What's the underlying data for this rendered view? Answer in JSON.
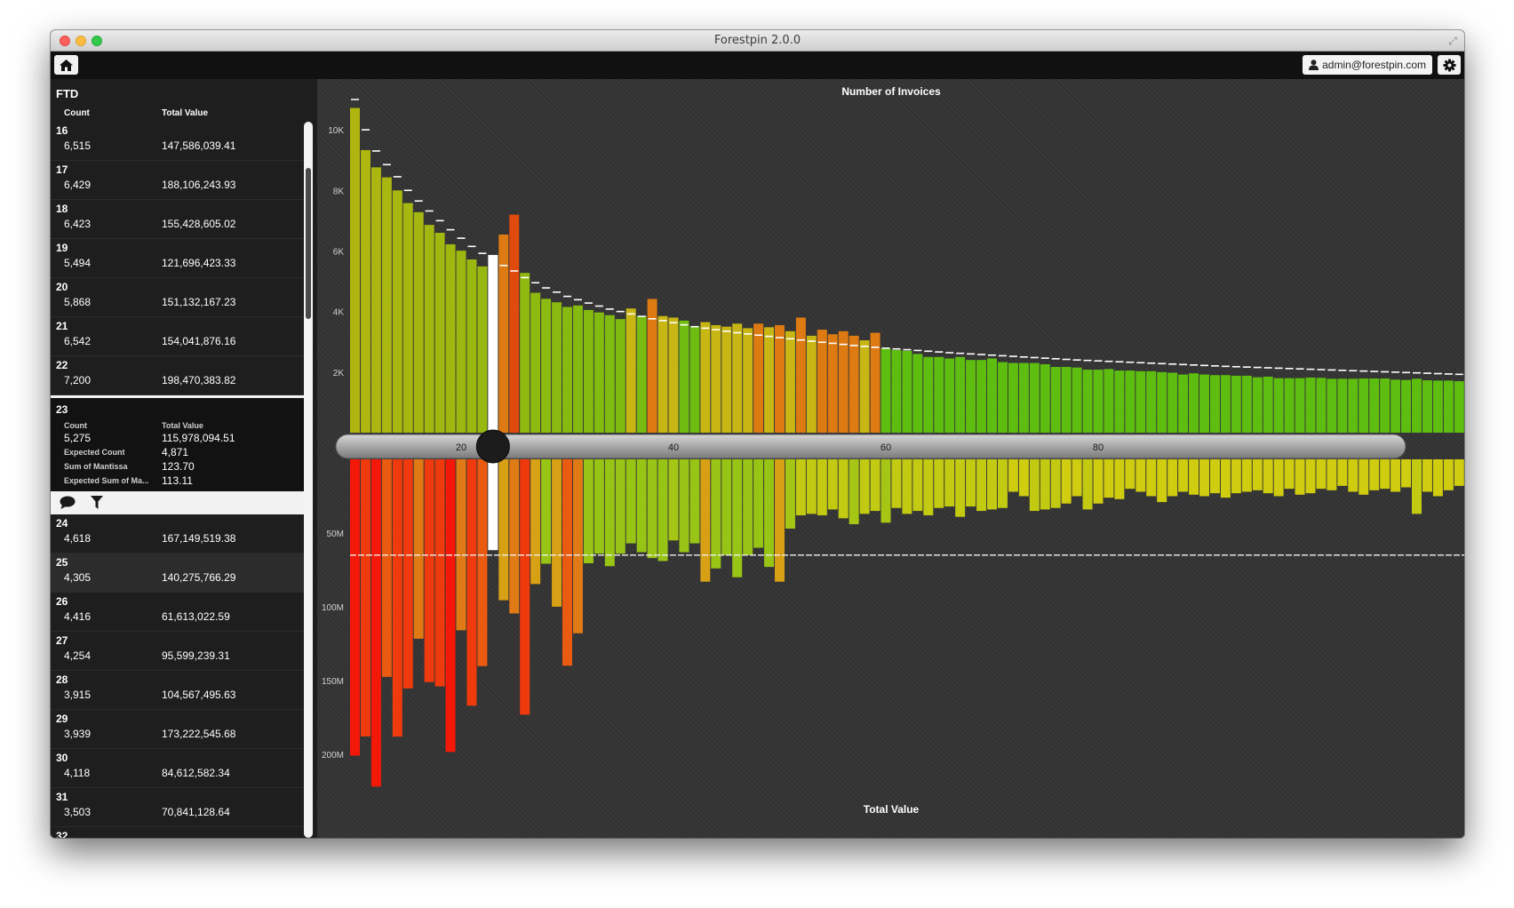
{
  "window": {
    "title": "Forestpin 2.0.0"
  },
  "toolbar": {
    "user": "admin@forestpin.com",
    "home_icon": "home-icon",
    "settings_icon": "gear-icon"
  },
  "sidebar": {
    "title": "FTD",
    "col_count": "Count",
    "col_total": "Total Value",
    "rows_before": [
      {
        "key": "16",
        "count": "6,515",
        "total": "147,586,039.41"
      },
      {
        "key": "17",
        "count": "6,429",
        "total": "188,106,243.93"
      },
      {
        "key": "18",
        "count": "6,423",
        "total": "155,428,605.02"
      },
      {
        "key": "19",
        "count": "5,494",
        "total": "121,696,423.33"
      },
      {
        "key": "20",
        "count": "5,868",
        "total": "151,132,167.23"
      },
      {
        "key": "21",
        "count": "6,542",
        "total": "154,041,876.16"
      },
      {
        "key": "22",
        "count": "7,200",
        "total": "198,470,383.82"
      }
    ],
    "selected": {
      "key": "23",
      "count_label": "Count",
      "total_label": "Total Value",
      "count": "5,275",
      "total": "115,978,094.51",
      "expected_count_label": "Expected Count",
      "expected_count": "4,871",
      "sum_mantissa_label": "Sum of Mantissa",
      "sum_mantissa": "123.70",
      "expected_sum_label": "Expected Sum of Ma...",
      "expected_sum": "113.11"
    },
    "tools": {
      "comment_icon": "comment-icon",
      "filter_icon": "filter-icon"
    },
    "rows_after": [
      {
        "key": "24",
        "count": "4,618",
        "total": "167,149,519.38"
      },
      {
        "key": "25",
        "count": "4,305",
        "total": "140,275,766.29"
      },
      {
        "key": "26",
        "count": "4,416",
        "total": "61,613,022.59"
      },
      {
        "key": "27",
        "count": "4,254",
        "total": "95,599,239.31"
      },
      {
        "key": "28",
        "count": "3,915",
        "total": "104,567,495.63"
      },
      {
        "key": "29",
        "count": "3,939",
        "total": "173,222,545.68"
      },
      {
        "key": "30",
        "count": "4,118",
        "total": "84,612,582.34"
      },
      {
        "key": "31",
        "count": "3,503",
        "total": "70,841,128.64"
      },
      {
        "key": "32",
        "count": "",
        "total": ""
      }
    ]
  },
  "chart_data": {
    "type": "bar",
    "top": {
      "title": "Number of Invoices",
      "ylim": [
        0,
        11000
      ],
      "yticks": [
        2000,
        4000,
        6000,
        8000,
        10000
      ],
      "ytick_labels": [
        "2K",
        "4K",
        "6K",
        "8K",
        "10K"
      ],
      "x_start": 10,
      "counts": [
        10720,
        9330,
        8760,
        8430,
        8000,
        7580,
        7280,
        6860,
        6600,
        6220,
        6010,
        5720,
        5490,
        5868,
        6542,
        7200,
        5275,
        4618,
        4420,
        4305,
        4150,
        4200,
        4050,
        3970,
        3880,
        3750,
        4100,
        3850,
        4416,
        3850,
        3800,
        3700,
        3500,
        3650,
        3550,
        3500,
        3600,
        3450,
        3600,
        3480,
        3550,
        3350,
        3800,
        3200,
        3400,
        3250,
        3350,
        3200,
        3050,
        3300,
        2780,
        2730,
        2700,
        2600,
        2500,
        2500,
        2450,
        2500,
        2400,
        2400,
        2450,
        2330,
        2300,
        2300,
        2300,
        2260,
        2170,
        2170,
        2150,
        2080,
        2080,
        2100,
        2050,
        2050,
        2030,
        2030,
        2000,
        1980,
        1920,
        1960,
        1920,
        1900,
        1900,
        1880,
        1880,
        1830,
        1850,
        1800,
        1800,
        1800,
        1820,
        1810,
        1780,
        1780,
        1780,
        1790,
        1790,
        1790,
        1750,
        1740,
        1780,
        1730,
        1720,
        1720,
        1700,
        1700,
        1680,
        1680,
        1650,
        1650,
        1640,
        1600,
        1640,
        1610,
        1600,
        1570,
        1560,
        1560,
        1560,
        1560
      ],
      "expected": [
        11000,
        10000,
        9300,
        8850,
        8450,
        8000,
        7650,
        7320,
        7000,
        6700,
        6420,
        6150,
        5920,
        5700,
        5520,
        5340,
        5120,
        4950,
        4780,
        4640,
        4500,
        4390,
        4280,
        4180,
        4080,
        4000,
        3920,
        3840,
        3760,
        3700,
        3630,
        3560,
        3500,
        3450,
        3400,
        3350,
        3300,
        3260,
        3220,
        3180,
        3140,
        3100,
        3060,
        3020,
        2985,
        2950,
        2915,
        2880,
        2850,
        2820,
        2790,
        2765,
        2740,
        2715,
        2690,
        2665,
        2640,
        2620,
        2600,
        2580,
        2560,
        2540,
        2520,
        2500,
        2480,
        2460,
        2440,
        2420,
        2400,
        2385,
        2370,
        2355,
        2340,
        2325,
        2310,
        2295,
        2280,
        2265,
        2250,
        2235,
        2220,
        2205,
        2190,
        2178,
        2166,
        2154,
        2142,
        2130,
        2118,
        2106,
        2094,
        2082,
        2070,
        2058,
        2046,
        2034,
        2022,
        2010,
        1998,
        1986,
        1974,
        1962,
        1950,
        1938,
        1926,
        1914,
        1902,
        1890,
        1878,
        1866,
        1854,
        1842,
        1830,
        1818,
        1806,
        1794,
        1782,
        1770,
        1758,
        1746
      ]
    },
    "bottom": {
      "title": "Total Value",
      "ylim": [
        0,
        220000000
      ],
      "yticks": [
        50000000,
        100000000,
        150000000,
        200000000
      ],
      "ytick_labels": [
        "50M",
        "100M",
        "150M",
        "200M"
      ],
      "average_line": 65000000,
      "values": [
        201000000,
        188000000,
        222000000,
        147586039,
        188106243,
        155428605,
        121696423,
        151132167,
        154041876,
        198470383,
        115978094,
        167149519,
        140275766,
        61613022,
        95599239,
        104567495,
        173222545,
        84612582,
        70841128,
        100000000,
        140000000,
        118000000,
        70500000,
        64000000,
        72500000,
        64000000,
        57000000,
        63000000,
        67000000,
        69000000,
        55000000,
        63000000,
        57000000,
        83000000,
        74000000,
        65000000,
        80000000,
        65000000,
        60000000,
        73000000,
        83000000,
        47000000,
        38000000,
        37000000,
        38000000,
        34000000,
        40000000,
        44000000,
        37000000,
        35000000,
        43000000,
        33000000,
        37000000,
        35000000,
        38000000,
        33000000,
        32000000,
        39000000,
        32000000,
        35000000,
        34000000,
        33000000,
        22000000,
        25000000,
        35000000,
        34000000,
        33000000,
        30000000,
        25000000,
        34000000,
        30000000,
        26000000,
        27000000,
        20000000,
        22000000,
        25000000,
        29000000,
        25000000,
        22000000,
        24000000,
        25000000,
        23000000,
        26000000,
        23000000,
        22000000,
        21000000,
        23000000,
        25000000,
        20000000,
        24000000,
        23000000,
        20000000,
        21000000,
        18000000,
        22000000,
        24000000,
        21000000,
        20000000,
        22000000,
        19000000,
        37000000,
        22000000,
        25000000,
        21000000,
        18000000,
        22000000,
        20000000,
        19000000,
        18000000,
        20000000,
        17000000,
        18000000,
        20000000,
        16000000,
        18000000,
        17000000,
        15000000,
        17000000,
        20000000,
        22000000
      ]
    },
    "slider": {
      "labels": [
        "20",
        "40",
        "60",
        "80"
      ],
      "label_values": [
        20,
        40,
        60,
        80
      ],
      "selected": 23
    }
  },
  "colors": {
    "window_bg": "#343434",
    "sidebar_bg": "#1e1e1e",
    "selected_bar": "#ffffff"
  }
}
